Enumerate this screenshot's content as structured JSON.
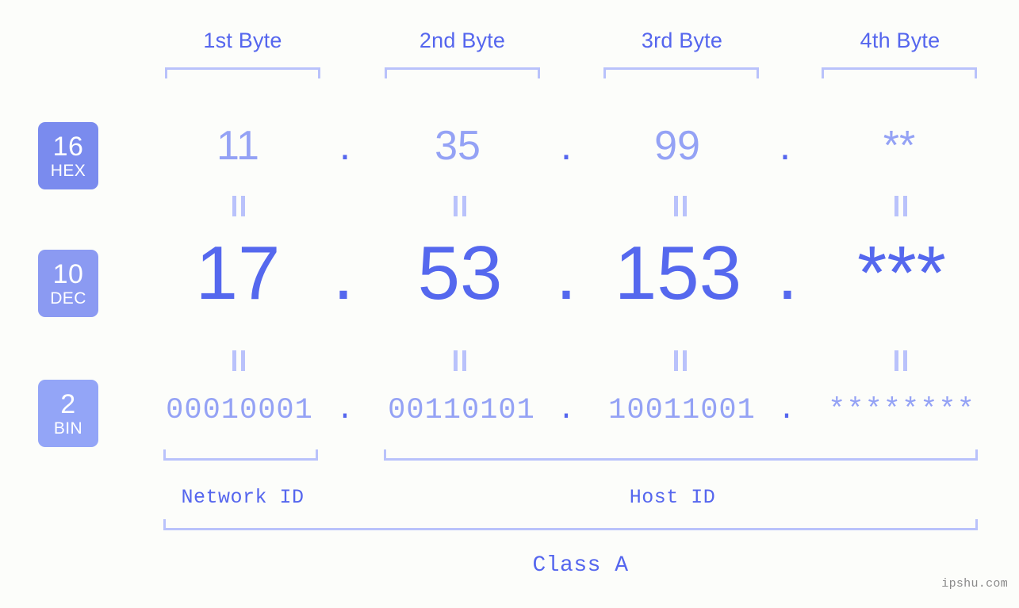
{
  "background_color": "#fcfdfa",
  "accent_colors": {
    "strong_blue": "#5566ee",
    "light_blue": "#94a2f5",
    "bracket_blue": "#b9c2fb",
    "badge_hex": "#7a8bee",
    "badge_dec": "#8b9af2",
    "badge_bin": "#93a5f7"
  },
  "headers": [
    {
      "label": "1st Byte"
    },
    {
      "label": "2nd Byte"
    },
    {
      "label": "3rd Byte"
    },
    {
      "label": "4th Byte"
    }
  ],
  "rows": [
    {
      "id": "hex",
      "badge_number": "16",
      "badge_label": "HEX",
      "values": [
        "11",
        "35",
        "99",
        "**"
      ],
      "separator": "."
    },
    {
      "id": "dec",
      "badge_number": "10",
      "badge_label": "DEC",
      "values": [
        "17",
        "53",
        "153",
        "***"
      ],
      "separator": "."
    },
    {
      "id": "bin",
      "badge_number": "2",
      "badge_label": "BIN",
      "values": [
        "00010001",
        "00110101",
        "10011001",
        "********"
      ],
      "separator": "."
    }
  ],
  "equality_marker": "=",
  "segments": [
    {
      "id": "network-id",
      "label": "Network ID"
    },
    {
      "id": "host-id",
      "label": "Host ID"
    }
  ],
  "class_label": "Class A",
  "watermark": "ipshu.com"
}
